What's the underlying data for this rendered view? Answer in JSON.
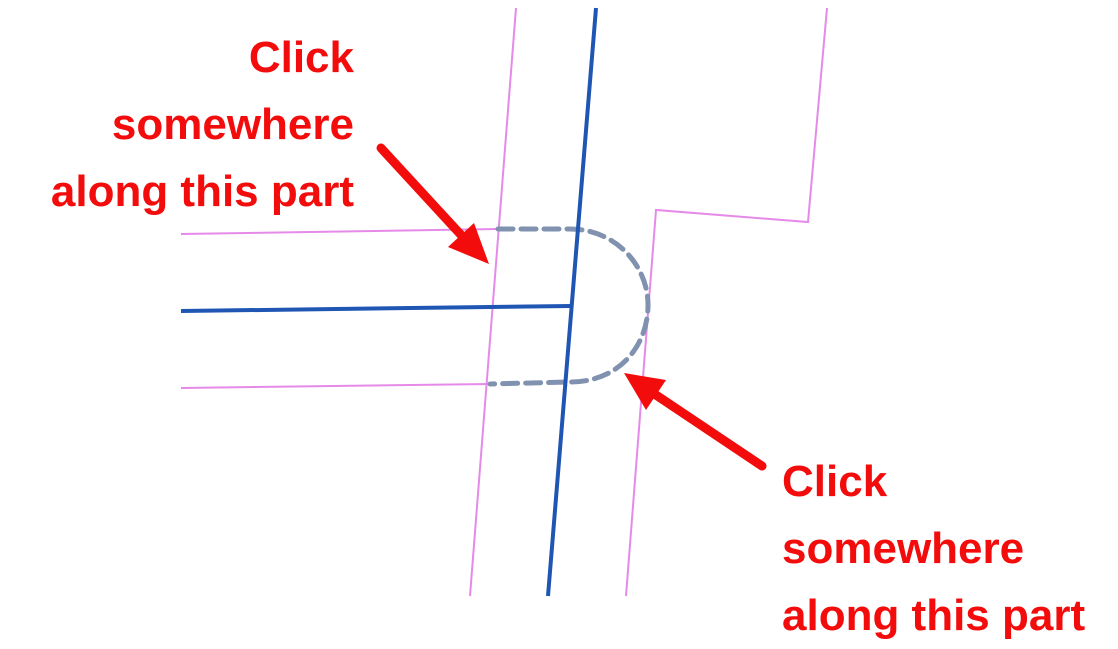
{
  "colors": {
    "road_centerline": "#1f56b4",
    "road_edge": "#e58ae8",
    "cul_de_sac_dashed": "#8092b0",
    "annotation": "#f20c0c",
    "background": "#ffffff"
  },
  "annotations": {
    "top": {
      "lines": [
        "Click",
        "somewhere",
        "along this part"
      ]
    },
    "bottom": {
      "lines": [
        "Click",
        "somewhere",
        "along this part"
      ]
    }
  }
}
